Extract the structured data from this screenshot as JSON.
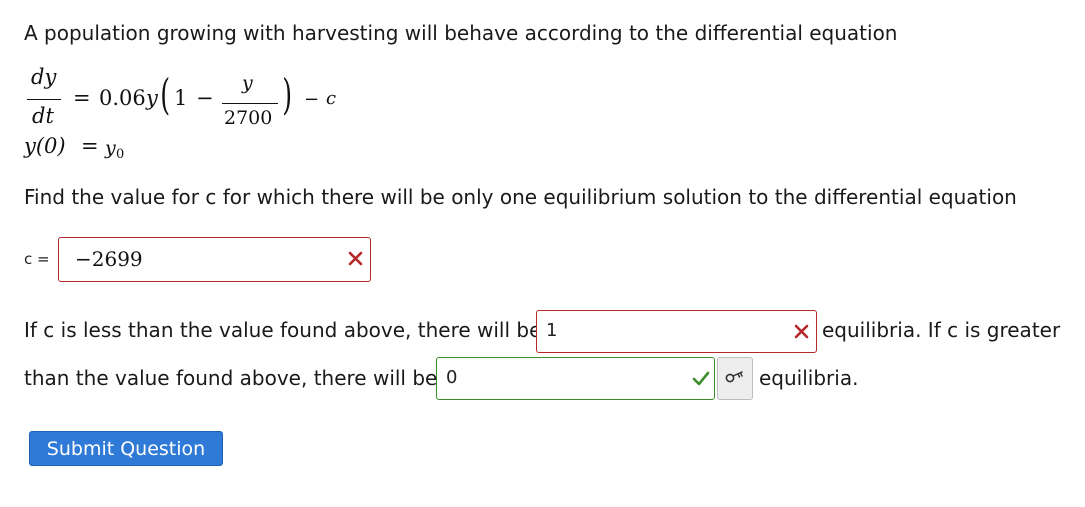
{
  "intro": "A population growing with harvesting will behave according to the differential equation",
  "equation": {
    "lhs_num": "dy",
    "lhs_den": "dt",
    "equals": "=",
    "coef": "0.06",
    "y": "y",
    "open_paren": "(",
    "one": "1",
    "minus1": "−",
    "inner_num": "y",
    "inner_den": "2700",
    "close_paren": ")",
    "minus2": "−",
    "c": "c",
    "ic_lhs": "y(0)",
    "ic_eq": "=",
    "ic_rhs_base": "y",
    "ic_rhs_sub": "0"
  },
  "find_text": "Find the value for c for which there will be only one equilibrium solution to the differential equation",
  "c_label": "c =",
  "c_answer": "−2699",
  "less_text": "If c is less than the value found above, there will be",
  "less_answer": "1",
  "less_suffix": "equilibria. If c is greater",
  "greater_text": "than the value found above, there will be",
  "greater_answer": "0",
  "greater_suffix": "equilibria.",
  "submit_label": "Submit Question",
  "colors": {
    "wrong": "#b5282b",
    "right": "#3a8f2a",
    "submit": "#2e7ad6"
  },
  "icons": {
    "wrong": "x-mark-icon",
    "right": "check-mark-icon",
    "key": "key-icon"
  }
}
